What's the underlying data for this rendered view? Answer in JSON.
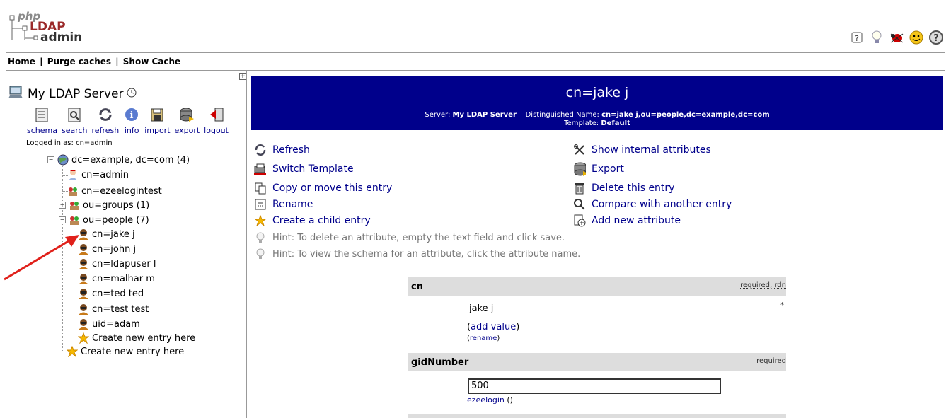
{
  "logo": {
    "php": "php",
    "ldap": "LDAP",
    "admin": "admin"
  },
  "top_icons": [
    "help-icon",
    "hint-bulb-icon",
    "bug-icon",
    "smiley-icon",
    "question-icon"
  ],
  "nav": {
    "home": "Home",
    "purge": "Purge caches",
    "show_cache": "Show Cache",
    "sep": "|"
  },
  "server": {
    "name": "My LDAP Server",
    "logged_in": "Logged in as: cn=admin"
  },
  "tools": [
    {
      "label": "schema",
      "icon": "schema-icon"
    },
    {
      "label": "search",
      "icon": "search-icon"
    },
    {
      "label": "refresh",
      "icon": "refresh-icon"
    },
    {
      "label": "info",
      "icon": "info-icon"
    },
    {
      "label": "import",
      "icon": "import-icon"
    },
    {
      "label": "export",
      "icon": "export-icon"
    },
    {
      "label": "logout",
      "icon": "logout-icon"
    }
  ],
  "tree": {
    "root": "dc=example, dc=com (4)",
    "admin": "cn=admin",
    "ezeelogintest": "cn=ezeelogintest",
    "groups": "ou=groups (1)",
    "people": "ou=people (7)",
    "people_children": [
      "cn=jake j",
      "cn=john j",
      "cn=ldapuser l",
      "cn=malhar m",
      "cn=ted ted",
      "cn=test test",
      "uid=adam"
    ],
    "create_child": "Create new entry here",
    "create_root": "Create new entry here"
  },
  "entry": {
    "title": "cn=jake j",
    "server_label": "Server:",
    "server_value": "My LDAP Server",
    "dn_label": "Distinguished Name:",
    "dn_value": "cn=jake j,ou=people,dc=example,dc=com",
    "template_label": "Template:",
    "template_value": "Default"
  },
  "actions_left": {
    "refresh": "Refresh",
    "switch_template": "Switch Template",
    "copy_move": "Copy or move this entry",
    "rename": "Rename",
    "create_child": "Create a child entry"
  },
  "actions_right": {
    "show_internal": "Show internal attributes",
    "export": "Export",
    "delete": "Delete this entry",
    "compare": "Compare with another entry",
    "add_attribute": "Add new attribute"
  },
  "hints": [
    "Hint: To delete an attribute, empty the text field and click save.",
    "Hint: To view the schema for an attribute, click the attribute name."
  ],
  "attributes": {
    "cn": {
      "name": "cn",
      "flags": "required, rdn",
      "value": "jake j",
      "add_value": "add value",
      "rename": "rename"
    },
    "gidNumber": {
      "name": "gidNumber",
      "flags": "required",
      "value": "500",
      "group": "ezeelogin",
      "group_suffix": "()"
    }
  },
  "annotation_color": "#e0201a"
}
